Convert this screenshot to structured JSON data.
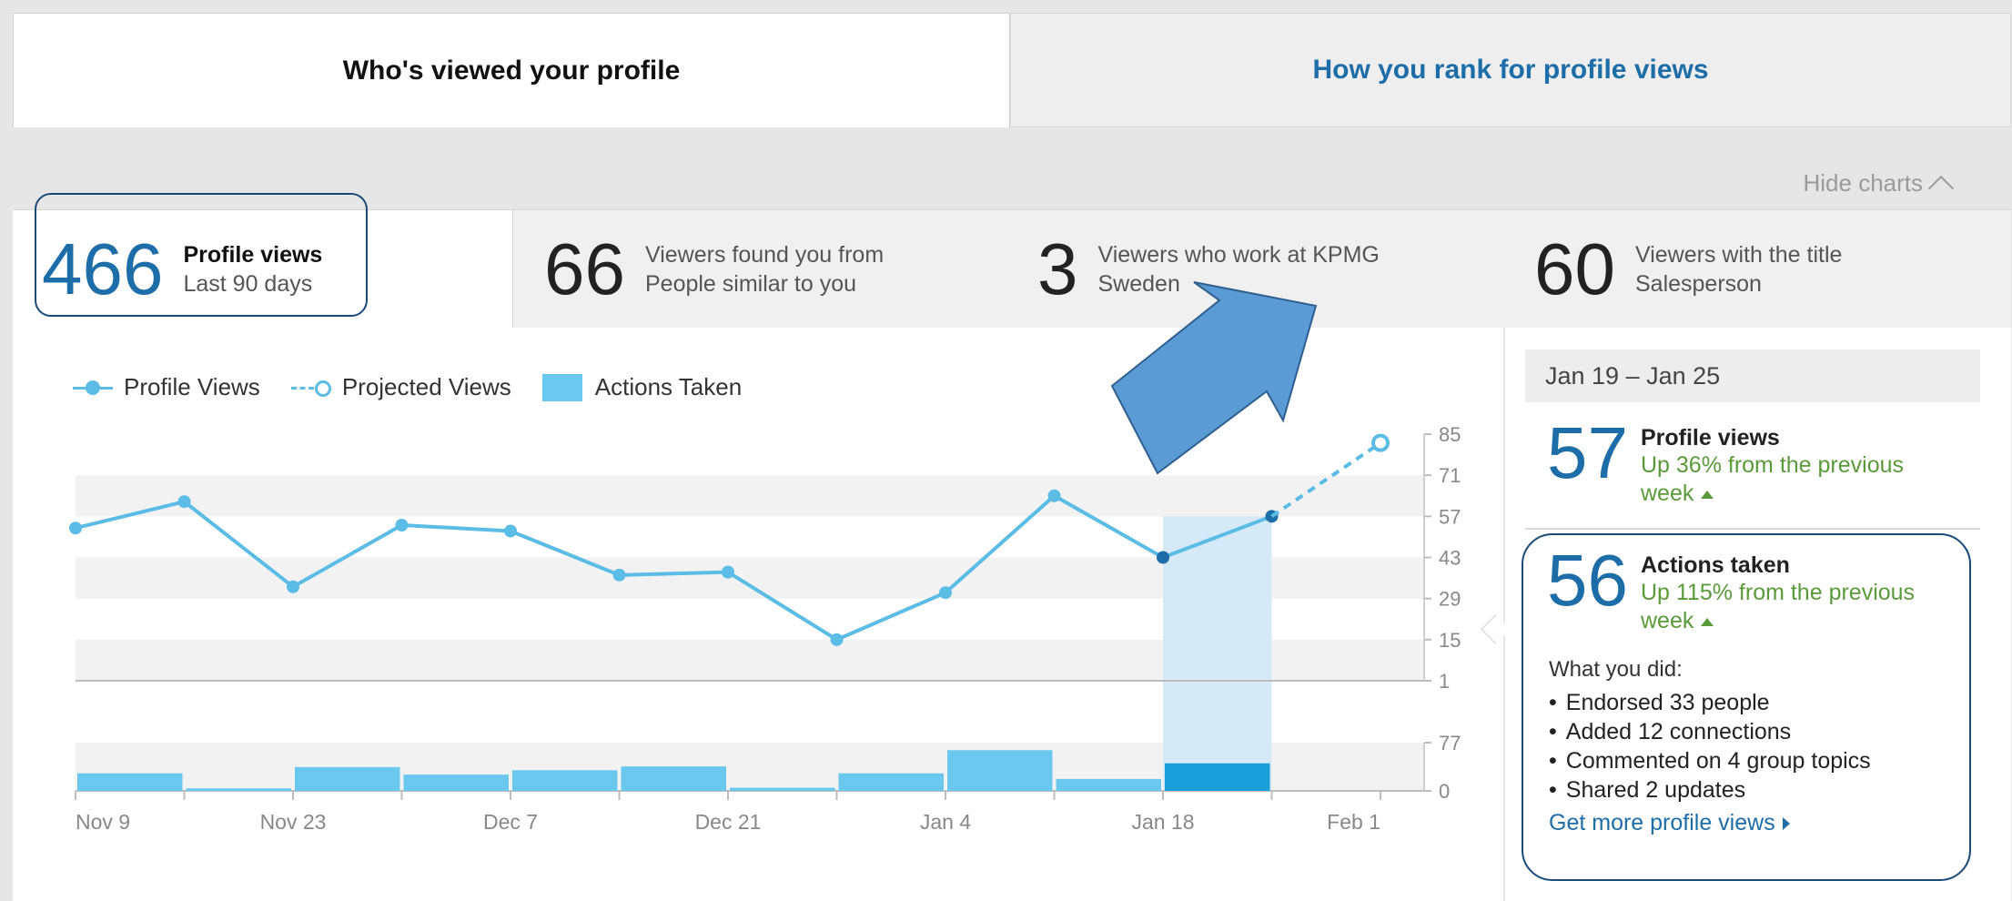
{
  "tabs": {
    "active": "Who's viewed your profile",
    "inactive": "How you rank for profile views"
  },
  "hide_charts_label": "Hide charts",
  "metrics": [
    {
      "number": "466",
      "line1": "Profile views",
      "line2": "Last 90 days"
    },
    {
      "number": "66",
      "line1": "Viewers found you from",
      "line2": "People similar to you"
    },
    {
      "number": "3",
      "line1": "Viewers who work at KPMG",
      "line2": "Sweden"
    },
    {
      "number": "60",
      "line1": "Viewers with the title",
      "line2": "Salesperson"
    }
  ],
  "legend": {
    "profile_views": "Profile Views",
    "projected_views": "Projected Views",
    "actions_taken": "Actions Taken"
  },
  "chart_data": {
    "type": "line",
    "x_tick_labels": [
      "Nov 9",
      "Nov 23",
      "Dec 7",
      "Dec 21",
      "Jan 4",
      "Jan 18",
      "Feb 1"
    ],
    "y_ticks": [
      85,
      71,
      57,
      43,
      29,
      15,
      1
    ],
    "y2_ticks": [
      77,
      0
    ],
    "series": [
      {
        "name": "Profile Views",
        "type": "line",
        "values": [
          53,
          62,
          33,
          54,
          52,
          37,
          38,
          15,
          31,
          64,
          43,
          57
        ]
      },
      {
        "name": "Projected Views",
        "type": "line-dashed",
        "values": [
          57,
          82
        ]
      },
      {
        "name": "Actions Taken",
        "type": "bar",
        "values": [
          28,
          4,
          38,
          26,
          33,
          39,
          5,
          28,
          65,
          19,
          44
        ]
      }
    ],
    "highlight_week_index": 10,
    "colors": {
      "line": "#5bbce6",
      "bar": "#6ac8ee",
      "bar_highlight": "#1b9fd9",
      "band": "#f2f2f2",
      "highlight_column": "#d6e9f7"
    }
  },
  "right_panel": {
    "week_range": "Jan 19 – Jan 25",
    "profile_views": {
      "number": "57",
      "title": "Profile views",
      "sub": "Up 36% from the previous week"
    },
    "actions_taken": {
      "number": "56",
      "title": "Actions taken",
      "sub": "Up 115% from the previous week"
    },
    "what_you_did_label": "What you did:",
    "items": [
      "Endorsed 33 people",
      "Added 12 connections",
      "Commented on 4 group topics",
      "Shared 2 updates"
    ],
    "get_more_link": "Get more profile views"
  },
  "accent_color": "#1d6ea8",
  "positive_color": "#5a9a3a"
}
